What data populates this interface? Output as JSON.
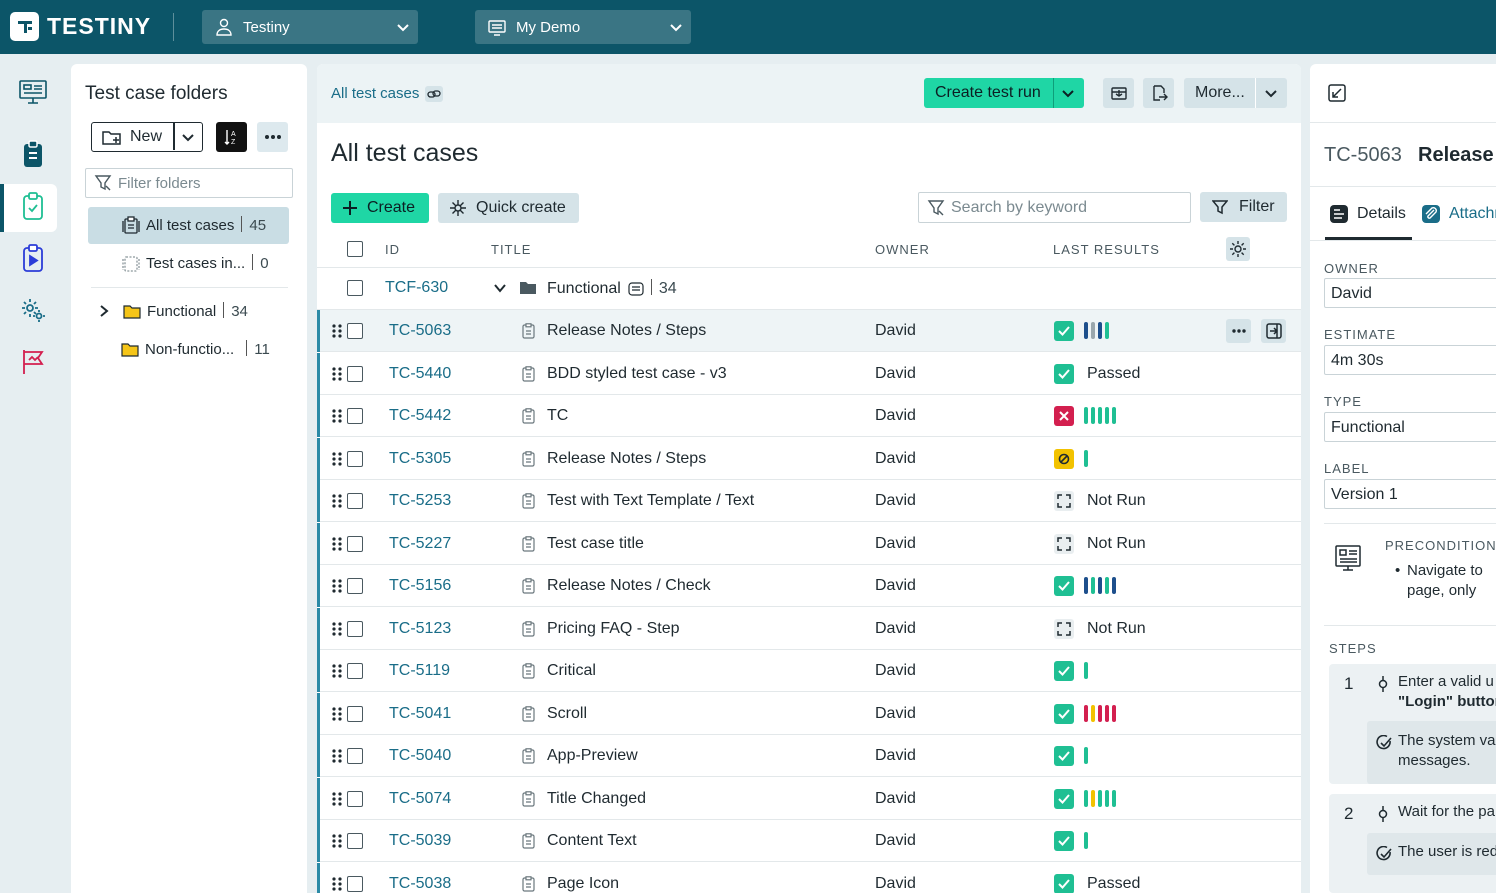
{
  "app": {
    "logo_text": "TESTINY",
    "workspace": "Testiny",
    "project": "My Demo"
  },
  "colors": {
    "topbar": "#0c5568",
    "accent": "#1fd6a5",
    "link": "#1a6d88",
    "passed": "#1fbf93",
    "failed": "#d31f4f",
    "blocked": "#f2c200",
    "retest": "#1d4f8c"
  },
  "rail": {
    "items": [
      "dashboard-icon",
      "test-cases-icon",
      "test-runs-icon",
      "test-plans-icon",
      "settings-icon",
      "milestones-icon"
    ]
  },
  "folders": {
    "title": "Test case folders",
    "new_label": "New",
    "filter_placeholder": "Filter folders",
    "items": [
      {
        "label": "All test cases",
        "count": "45"
      },
      {
        "label": "Test cases in...",
        "count": "0"
      },
      {
        "label": "Functional",
        "count": "34"
      },
      {
        "label": "Non-functio...",
        "count": "11"
      }
    ]
  },
  "main": {
    "breadcrumb": "All test cases",
    "create_run_label": "Create test run",
    "more_label": "More...",
    "title": "All test cases",
    "create_label": "Create",
    "quick_create_label": "Quick create",
    "search_placeholder": "Search by keyword",
    "filter_label": "Filter",
    "columns": {
      "id": "ID",
      "title": "TITLE",
      "owner": "OWNER",
      "results": "LAST RESULTS"
    },
    "group": {
      "id": "TCF-630",
      "name": "Functional",
      "count": "34"
    },
    "rows": [
      {
        "id": "TC-5063",
        "title": "Release Notes / Steps",
        "owner": "David",
        "status": "passed",
        "bars": [
          "retest",
          "grey",
          "retest",
          "passed"
        ],
        "text": ""
      },
      {
        "id": "TC-5440",
        "title": "BDD styled test case - v3",
        "owner": "David",
        "status": "passed",
        "bars": [],
        "text": "Passed"
      },
      {
        "id": "TC-5442",
        "title": "TC",
        "owner": "David",
        "status": "failed",
        "bars": [
          "passed",
          "passed",
          "passed",
          "passed",
          "passed"
        ],
        "text": ""
      },
      {
        "id": "TC-5305",
        "title": "Release Notes / Steps",
        "owner": "David",
        "status": "blocked",
        "bars": [
          "passed"
        ],
        "text": ""
      },
      {
        "id": "TC-5253",
        "title": "Test with Text Template / Text",
        "owner": "David",
        "status": "notrun",
        "bars": [],
        "text": "Not Run"
      },
      {
        "id": "TC-5227",
        "title": "Test case title",
        "owner": "David",
        "status": "notrun",
        "bars": [],
        "text": "Not Run"
      },
      {
        "id": "TC-5156",
        "title": "Release Notes / Check",
        "owner": "David",
        "status": "passed",
        "bars": [
          "retest",
          "passed",
          "retest",
          "passed",
          "retest"
        ],
        "text": ""
      },
      {
        "id": "TC-5123",
        "title": "Pricing FAQ - Step",
        "owner": "David",
        "status": "notrun",
        "bars": [],
        "text": "Not Run"
      },
      {
        "id": "TC-5119",
        "title": "Critical",
        "owner": "David",
        "status": "passed",
        "bars": [
          "passed"
        ],
        "text": ""
      },
      {
        "id": "TC-5041",
        "title": "Scroll",
        "owner": "David",
        "status": "passed",
        "bars": [
          "failed",
          "blocked",
          "failed",
          "failed",
          "failed"
        ],
        "text": ""
      },
      {
        "id": "TC-5040",
        "title": "App-Preview",
        "owner": "David",
        "status": "passed",
        "bars": [
          "passed"
        ],
        "text": ""
      },
      {
        "id": "TC-5074",
        "title": "Title Changed",
        "owner": "David",
        "status": "passed",
        "bars": [
          "passed",
          "blocked",
          "passed",
          "passed",
          "passed"
        ],
        "text": ""
      },
      {
        "id": "TC-5039",
        "title": "Content Text",
        "owner": "David",
        "status": "passed",
        "bars": [
          "passed"
        ],
        "text": ""
      },
      {
        "id": "TC-5038",
        "title": "Page Icon",
        "owner": "David",
        "status": "passed",
        "bars": [],
        "text": "Passed"
      }
    ]
  },
  "side": {
    "case_id": "TC-5063",
    "case_title": "Release N",
    "tab_details": "Details",
    "tab_attach": "Attachm",
    "owner_label": "OWNER",
    "owner": "David",
    "estimate_label": "ESTIMATE",
    "estimate": "4m 30s",
    "type_label": "TYPE",
    "type": "Functional",
    "label_label": "LABEL",
    "label": "Version 1",
    "precondition_label": "PRECONDITION",
    "precondition_line1": "Navigate to",
    "precondition_line2": "page, only",
    "steps_label": "STEPS",
    "step1_num": "1",
    "step1_line1": "Enter a valid u",
    "step1_line2": "\"Login\" button",
    "step1_res1": "The system va",
    "step1_res2": "messages.",
    "step2_num": "2",
    "step2_line1": "Wait for the pa",
    "step2_res1": "The user is red"
  }
}
